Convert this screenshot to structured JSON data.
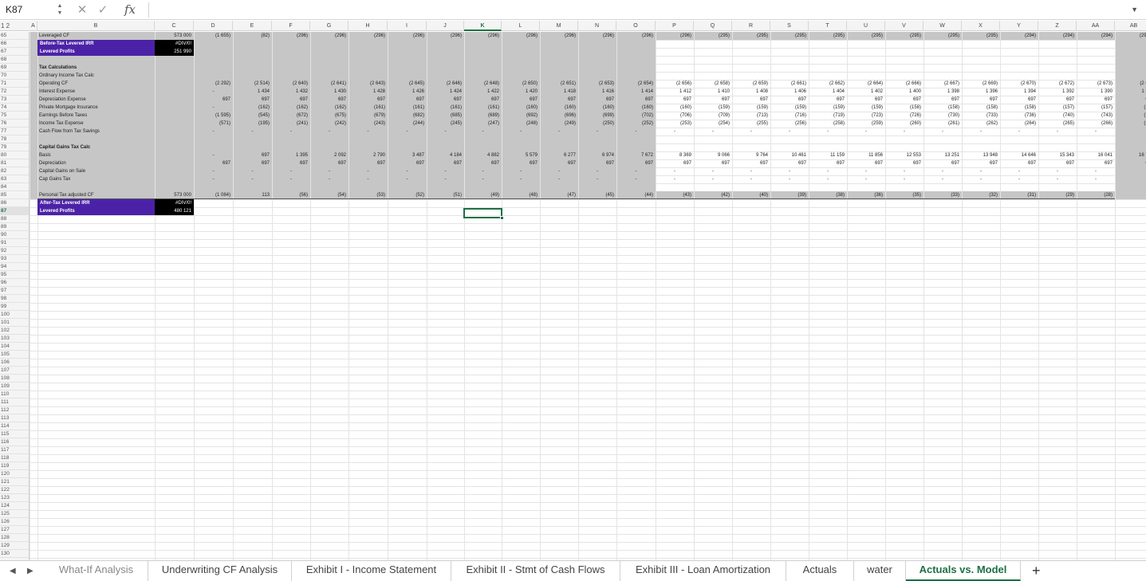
{
  "formula_bar": {
    "name_box": "K87",
    "cancel_icon": "✕",
    "enter_icon": "✓",
    "fx_label": "fx",
    "formula": ""
  },
  "outline_levels": "1 2",
  "columns": [
    "A",
    "B",
    "C",
    "D",
    "E",
    "F",
    "G",
    "H",
    "I",
    "J",
    "K",
    "L",
    "M",
    "N",
    "O",
    "P",
    "Q",
    "R",
    "S",
    "T",
    "U",
    "V",
    "W",
    "X",
    "Y",
    "Z",
    "AA",
    "AB"
  ],
  "selected_column": "K",
  "rows": [
    "65",
    "66",
    "67",
    "68",
    "69",
    "70",
    "71",
    "72",
    "73",
    "74",
    "75",
    "76",
    "77",
    "78",
    "79",
    "80",
    "81",
    "82",
    "83",
    "84",
    "85",
    "86",
    "87",
    "88",
    "89",
    "90",
    "91",
    "92",
    "93",
    "94",
    "95",
    "96",
    "97",
    "98",
    "99",
    "100",
    "101",
    "102",
    "103",
    "104",
    "105",
    "106",
    "107",
    "108",
    "109",
    "110",
    "111",
    "112",
    "113",
    "114",
    "115",
    "116",
    "117",
    "118",
    "119",
    "120",
    "121",
    "122",
    "123",
    "124",
    "125",
    "126",
    "127",
    "128",
    "129",
    "130"
  ],
  "selected_row": "87",
  "labels": {
    "r65": "Leveraged CF",
    "r66": "Before-Tax Levered IRR",
    "r67": "Levered Profits",
    "r69": "Tax Calculations",
    "r70": "Ordinary Income Tax Calc",
    "r71": "Operating CF",
    "r72": "Interest Expense",
    "r73": "Depreciation Expense",
    "r74": "Private Mortgage Insurance",
    "r75": "Earnings Before Taxes",
    "r76": "Income Tax Expense",
    "r77": "Cash Flow from Tax Savings",
    "r79": "Capital Gains Tax Calc",
    "r80": "Basis",
    "r81": "Depreciation",
    "r82": "Capital Gains on Sale",
    "r83": "Cap Gains Tax",
    "r85": "Personal Tax adjusted CF",
    "r86": "After-Tax Levered IRR",
    "r87": "Levered Profits"
  },
  "colC": {
    "r65": "573 000",
    "r66": "#DIV/0!",
    "r67": "251 990",
    "r85": "573 000",
    "r86": "#DIV/0!",
    "r87": "480 121"
  },
  "table": {
    "r65": [
      "(1 655)",
      "(82)",
      "(296)",
      "(296)",
      "(296)",
      "(296)",
      "(296)",
      "(296)",
      "(296)",
      "(296)",
      "(296)",
      "(296)",
      "(296)",
      "(295)",
      "(295)",
      "(295)",
      "(295)",
      "(295)",
      "(295)",
      "(295)",
      "(295)",
      "(294)",
      "(294)",
      "(294)",
      "(294)",
      "(29"
    ],
    "r71": [
      "(2 292)",
      "(2 514)",
      "(2 640)",
      "(2 641)",
      "(2 643)",
      "(2 645)",
      "(2 646)",
      "(2 648)",
      "(2 650)",
      "(2 651)",
      "(2 653)",
      "(2 654)",
      "(2 656)",
      "(2 658)",
      "(2 659)",
      "(2 661)",
      "(2 662)",
      "(2 664)",
      "(2 666)",
      "(2 667)",
      "(2 669)",
      "(2 670)",
      "(2 672)",
      "(2 673)",
      "(2 67"
    ],
    "r72": [
      "-",
      "1 434",
      "1 432",
      "1 430",
      "1 428",
      "1 426",
      "1 424",
      "1 422",
      "1 420",
      "1 418",
      "1 416",
      "1 414",
      "1 412",
      "1 410",
      "1 408",
      "1 406",
      "1 404",
      "1 402",
      "1 400",
      "1 398",
      "1 396",
      "1 394",
      "1 392",
      "1 390",
      "1 38"
    ],
    "r73": [
      "697",
      "697",
      "697",
      "697",
      "697",
      "697",
      "697",
      "697",
      "697",
      "697",
      "697",
      "697",
      "697",
      "697",
      "697",
      "697",
      "697",
      "697",
      "697",
      "697",
      "697",
      "697",
      "697",
      "697",
      "69"
    ],
    "r74": [
      "-",
      "(162)",
      "(162)",
      "(162)",
      "(161)",
      "(161)",
      "(161)",
      "(161)",
      "(160)",
      "(160)",
      "(160)",
      "(160)",
      "(160)",
      "(159)",
      "(159)",
      "(159)",
      "(159)",
      "(159)",
      "(158)",
      "(158)",
      "(158)",
      "(158)",
      "(157)",
      "(157)",
      "(15"
    ],
    "r75": [
      "(1 595)",
      "(545)",
      "(672)",
      "(675)",
      "(679)",
      "(682)",
      "(685)",
      "(689)",
      "(692)",
      "(696)",
      "(699)",
      "(702)",
      "(706)",
      "(709)",
      "(713)",
      "(716)",
      "(719)",
      "(723)",
      "(726)",
      "(730)",
      "(733)",
      "(736)",
      "(740)",
      "(743)",
      "(74"
    ],
    "r76": [
      "(571)",
      "(195)",
      "(241)",
      "(242)",
      "(243)",
      "(244)",
      "(245)",
      "(247)",
      "(248)",
      "(249)",
      "(250)",
      "(252)",
      "(253)",
      "(254)",
      "(255)",
      "(256)",
      "(258)",
      "(259)",
      "(260)",
      "(261)",
      "(262)",
      "(264)",
      "(265)",
      "(266)",
      "(26"
    ],
    "r77": [
      "-",
      "-",
      "-",
      "-",
      "-",
      "-",
      "-",
      "-",
      "-",
      "-",
      "-",
      "-",
      "-",
      "-",
      "-",
      "-",
      "-",
      "-",
      "-",
      "-",
      "-",
      "-",
      "-",
      "-",
      ""
    ],
    "r80": [
      "-",
      "697",
      "1 395",
      "2 092",
      "2 790",
      "3 487",
      "4 184",
      "4 882",
      "5 579",
      "6 277",
      "6 974",
      "7 672",
      "8 369",
      "9 066",
      "9 764",
      "10 461",
      "11 159",
      "11 856",
      "12 553",
      "13 251",
      "13 948",
      "14 646",
      "15 343",
      "16 041",
      "16 73"
    ],
    "r81": [
      "697",
      "697",
      "697",
      "697",
      "697",
      "697",
      "697",
      "697",
      "697",
      "697",
      "697",
      "697",
      "697",
      "697",
      "697",
      "697",
      "697",
      "697",
      "697",
      "697",
      "697",
      "697",
      "697",
      "697",
      "69"
    ],
    "r82": [
      "-",
      "-",
      "-",
      "-",
      "-",
      "-",
      "-",
      "-",
      "-",
      "-",
      "-",
      "-",
      "-",
      "-",
      "-",
      "-",
      "-",
      "-",
      "-",
      "-",
      "-",
      "-",
      "-",
      "-",
      ""
    ],
    "r83": [
      "-",
      "-",
      "-",
      "-",
      "-",
      "-",
      "-",
      "-",
      "-",
      "-",
      "-",
      "-",
      "-",
      "-",
      "-",
      "-",
      "-",
      "-",
      "-",
      "-",
      "-",
      "-",
      "-",
      "-",
      ""
    ],
    "r85": [
      "(1 084)",
      "113",
      "(56)",
      "(54)",
      "(53)",
      "(52)",
      "(51)",
      "(49)",
      "(48)",
      "(47)",
      "(45)",
      "(44)",
      "(43)",
      "(42)",
      "(40)",
      "(39)",
      "(38)",
      "(36)",
      "(35)",
      "(33)",
      "(32)",
      "(31)",
      "(29)",
      "(28)",
      "(2"
    ]
  },
  "sheet_tabs": [
    "What-If Analysis",
    "Underwriting CF Analysis",
    "Exhibit I - Income Statement",
    "Exhibit II - Stmt of Cash Flows",
    "Exhibit III - Loan Amortization",
    "Actuals",
    "water",
    "Actuals vs. Model"
  ],
  "active_tab": "Actuals vs. Model",
  "add_sheet_label": "+",
  "colors": {
    "accent_green": "#1d7044",
    "purple": "#4b22a7",
    "band_gray": "#c6c6c6"
  }
}
